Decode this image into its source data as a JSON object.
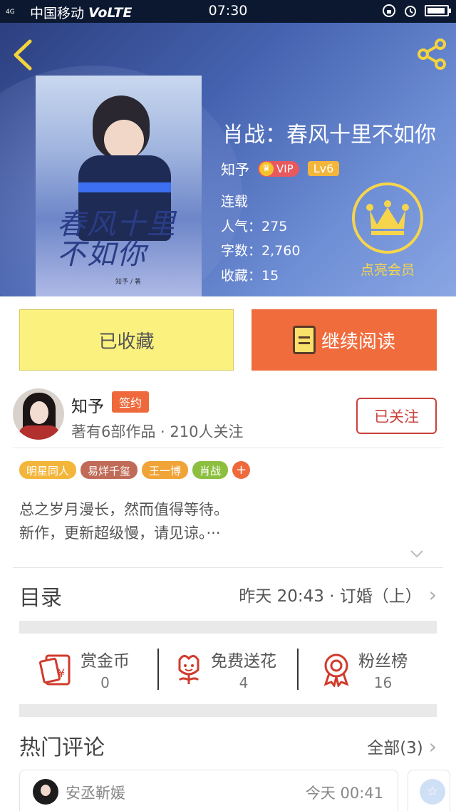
{
  "status_bar": {
    "signal": "4G",
    "carrier": "中国移动",
    "volte": "VoLTE",
    "time": "07:30"
  },
  "book": {
    "title": "肖战：春风十里不如你",
    "author": "知予",
    "vip_label": "VIP",
    "level": "Lv6",
    "status": "连载",
    "popularity_label": "人气：",
    "popularity": "275",
    "words_label": "字数：",
    "words": "2,760",
    "favorites_label": "收藏：",
    "favorites": "15",
    "member_label": "点亮会员",
    "cover": {
      "title_art": "春风十里不如你",
      "author_art": "知予 / 著"
    }
  },
  "actions": {
    "favorited_label": "已收藏",
    "continue_label": "继续阅读"
  },
  "author": {
    "name": "知予",
    "signed_badge": "签约",
    "summary": "著有6部作品 · 210人关注",
    "follow_label": "已关注"
  },
  "tags": [
    {
      "label": "明星同人",
      "color": "#f3b63b"
    },
    {
      "label": "易烊千玺",
      "color": "#c06b58"
    },
    {
      "label": "王一博",
      "color": "#f0a437"
    },
    {
      "label": "肖战",
      "color": "#8cbf3f"
    },
    {
      "label": "+",
      "color": "#ee6a3c"
    }
  ],
  "description": {
    "line1": "总之岁月漫长，然而值得等待。",
    "line2": "新作，更新超级慢，请见谅。···"
  },
  "toc": {
    "label": "目录",
    "latest": "昨天 20:43 · 订婚（上）"
  },
  "rewards": [
    {
      "label": "赏金币",
      "count": "0",
      "icon": "red-envelope-icon"
    },
    {
      "label": "免费送花",
      "count": "4",
      "icon": "flower-icon"
    },
    {
      "label": "粉丝榜",
      "count": "16",
      "icon": "medal-icon"
    }
  ],
  "comments": {
    "label": "热门评论",
    "all_label": "全部(3)",
    "items": [
      {
        "user": "安丞靳媛",
        "time": "今天 00:41"
      }
    ]
  },
  "colors": {
    "accent_orange": "#f06c3d",
    "fav_yellow": "#fbf17f",
    "crown_yellow": "#f6d54d",
    "follow_red": "#c9423d"
  }
}
